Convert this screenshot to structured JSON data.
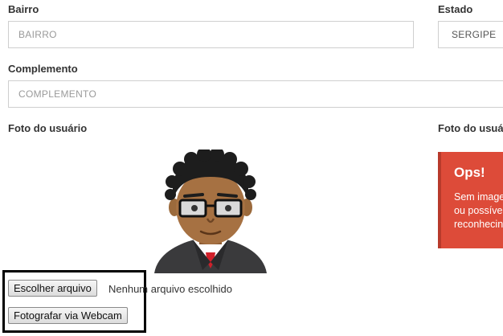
{
  "address": {
    "bairro_label": "Bairro",
    "bairro_placeholder": "BAIRRO",
    "estado_label": "Estado",
    "estado_value": "SERGIPE",
    "complemento_label": "Complemento",
    "complemento_placeholder": "COMPLEMENTO"
  },
  "photo": {
    "label": "Foto do usuário",
    "label_right": "Foto do usuá",
    "choose_file_button": "Escolher arquivo",
    "no_file_text": "Nenhum arquivo escolhido",
    "webcam_button": "Fotografar via Webcam"
  },
  "alert": {
    "title": "Ops!",
    "lines": [
      "Sem image",
      "ou possíve",
      "reconhecin"
    ],
    "color": "#dd4b39"
  }
}
